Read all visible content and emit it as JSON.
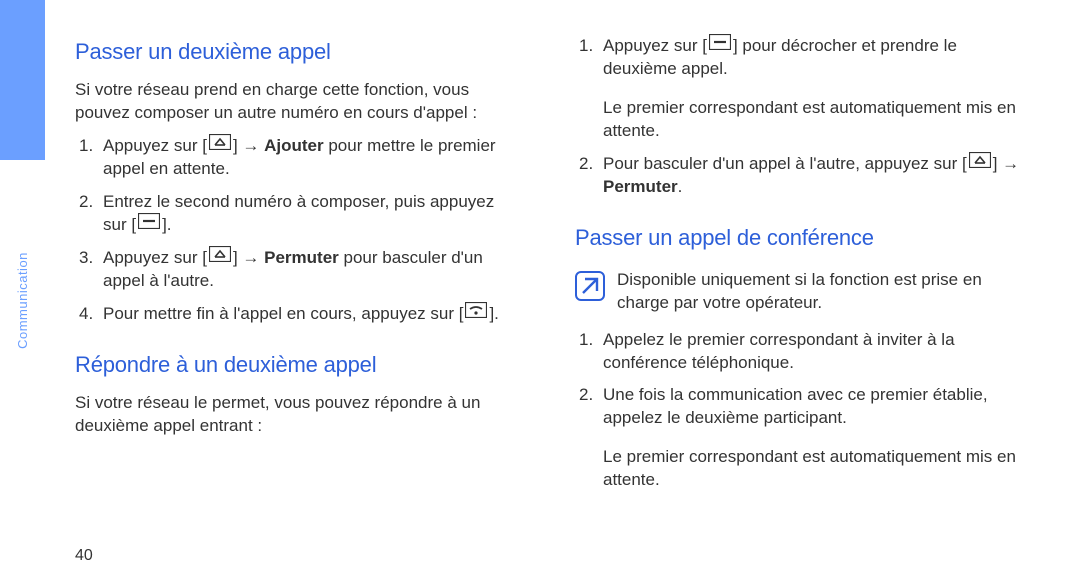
{
  "sidebar": {
    "label": "Communication"
  },
  "pageNumber": "40",
  "col1": {
    "s1": {
      "heading": "Passer un deuxième appel",
      "intro": "Si votre réseau prend en charge cette fonction, vous pouvez composer un autre numéro en cours d'appel :",
      "li": [
        {
          "pre": "Appuyez sur [",
          "mid": "] → ",
          "bold": "Ajouter",
          "post": " pour mettre le premier appel en attente."
        },
        {
          "pre": "Entrez le second numéro à composer, puis appuyez sur [",
          "post": "]."
        },
        {
          "pre": "Appuyez sur [",
          "mid": "] → ",
          "bold": "Permuter",
          "post": " pour basculer d'un appel à l'autre."
        },
        {
          "pre": "Pour mettre fin à l'appel en cours, appuyez sur [",
          "post": "]."
        }
      ]
    },
    "s2": {
      "heading": "Répondre à un deuxième appel",
      "intro": "Si votre réseau le permet, vous pouvez répondre à un deuxième appel entrant :"
    }
  },
  "col2": {
    "cont": {
      "li": [
        {
          "pre": "Appuyez sur [",
          "post": "] pour décrocher et prendre le deuxième appel.",
          "sub": "Le premier correspondant est automatiquement mis en attente."
        },
        {
          "pre": "Pour basculer d'un appel à l'autre, appuyez sur [",
          "mid": "] → ",
          "bold": "Permuter",
          "post": "."
        }
      ]
    },
    "s3": {
      "heading": "Passer un appel de conférence",
      "note": "Disponible uniquement si la fonction est prise en charge par votre opérateur.",
      "li": [
        {
          "text": "Appelez le premier correspondant à inviter à la conférence téléphonique."
        },
        {
          "text": "Une fois la communication avec ce premier établie, appelez le deuxième participant.",
          "sub": "Le premier correspondant est automatiquement mis en attente."
        }
      ]
    }
  }
}
